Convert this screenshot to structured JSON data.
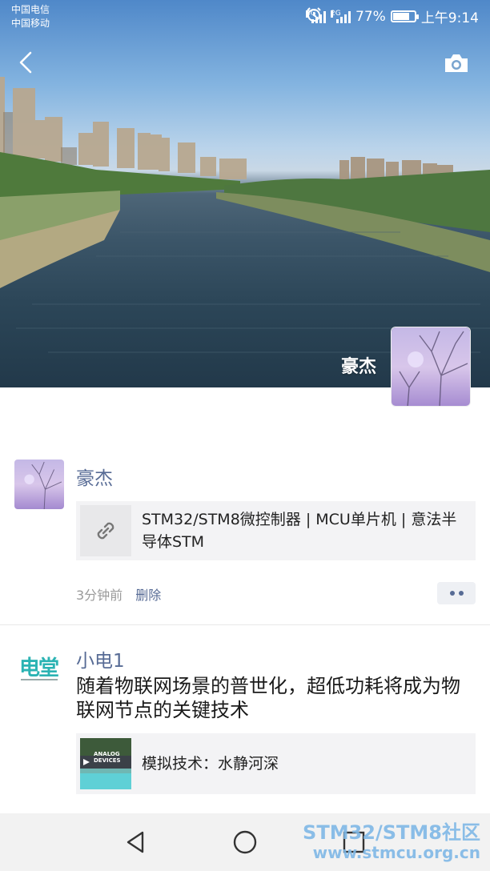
{
  "status_bar": {
    "carrier_1": "中国电信",
    "carrier_2": "中国移动",
    "signal_1_label": "4G",
    "signal_2_label": "2G",
    "battery": "77%",
    "battery_level": 0.77,
    "time": "上午9:14"
  },
  "header": {
    "back_icon": "chevron-left-icon",
    "camera_icon": "camera-icon",
    "cover_name": "豪杰"
  },
  "posts": [
    {
      "author": "豪杰",
      "link_icon": "link-icon",
      "link_title": "STM32/STM8微控制器 | MCU单片机 | 意法半导体STM",
      "time": "3分钟前",
      "delete": "删除"
    },
    {
      "author": "小电1",
      "text": "随着物联网场景的普世化，超低功耗将成为物联网节点的关键技术",
      "link_title": "模拟技术：水静河深",
      "thumb_brand": "ANALOG DEVICES",
      "avatar_brand": "电堂"
    }
  ],
  "watermark": {
    "line1": "STM32/STM8社区",
    "line2": "www.stmcu.org.cn"
  },
  "colors": {
    "link_blue": "#576b95",
    "card_bg": "#f3f3f5",
    "nav_bg": "#f2f2f2"
  }
}
